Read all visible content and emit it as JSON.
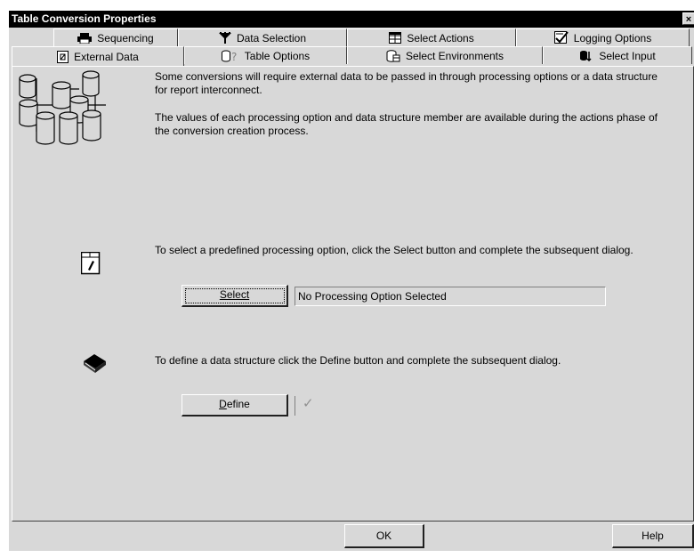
{
  "window": {
    "title": "Table Conversion Properties",
    "close_label": "×"
  },
  "tabs_row1": [
    {
      "label": "Sequencing",
      "icon": "printer-icon"
    },
    {
      "label": "Data Selection",
      "icon": "funnel-icon"
    },
    {
      "label": "Select Actions",
      "icon": "table-grid-icon"
    },
    {
      "label": "Logging Options",
      "icon": "log-check-icon"
    }
  ],
  "tabs_row2": [
    {
      "label": "External Data",
      "icon": "external-doc-icon",
      "active": true
    },
    {
      "label": "Table Options",
      "icon": "db-question-icon"
    },
    {
      "label": "Select Environments",
      "icon": "environment-icon"
    },
    {
      "label": "Select Input",
      "icon": "input-db-icon"
    }
  ],
  "content": {
    "intro_1": "Some conversions will require external data to be passed in through processing options or a data structure for report interconnect.",
    "intro_2": "The values of each processing option and data structure member are available during the actions phase of the conversion creation process.",
    "processing_text": "To select a predefined processing option, click the Select button and complete the subsequent dialog.",
    "select_label": "Select",
    "processing_value": "No Processing Option Selected",
    "define_text": "To define a data structure click the Define button and complete the subsequent dialog.",
    "define_label": "Define",
    "define_mnemonic": "D",
    "define_rest": "efine",
    "check_mark": "✓"
  },
  "footer": {
    "ok_label": "OK",
    "help_label": "Help"
  }
}
